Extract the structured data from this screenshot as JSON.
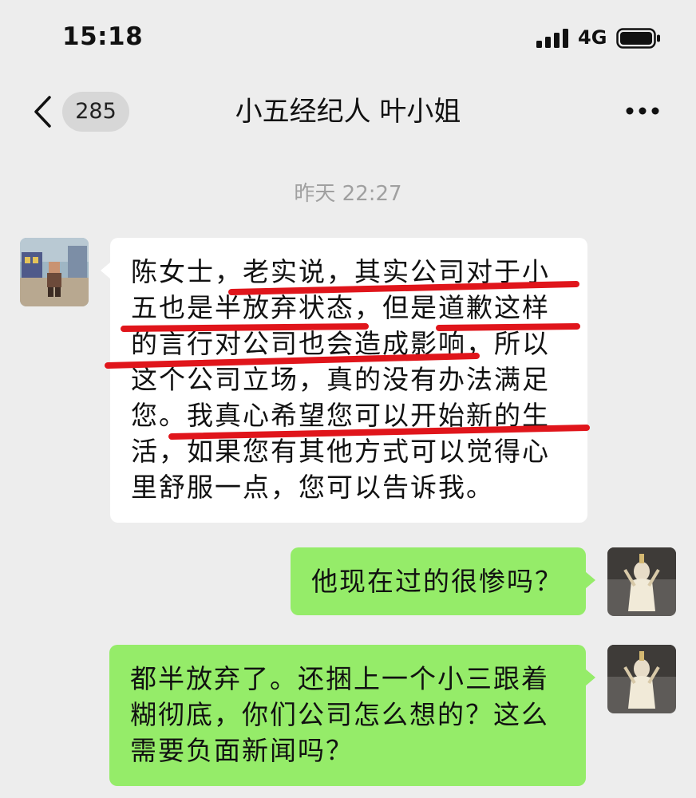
{
  "status_bar": {
    "time": "15:18",
    "network": "4G",
    "icons": [
      "signal-bars-icon",
      "battery-icon"
    ]
  },
  "nav": {
    "back_icon": "chevron-left-icon",
    "unread_count": "285",
    "title": "小五经纪人 叶小姐",
    "more_icon": "more-dots-icon"
  },
  "timestamp": "昨天 22:27",
  "messages": [
    {
      "sender": "contact",
      "avatar_icon": "game-character-avatar",
      "text": "陈女士，老实说，其实公司对于小五也是半放弃状态，但是道歉这样的言行对公司也会造成影响，所以这个公司立场，真的没有办法满足您。我真心希望您可以开始新的生活，如果您有其他方式可以觉得心里舒服一点，您可以告诉我。"
    },
    {
      "sender": "me",
      "avatar_icon": "goddess-statue-avatar",
      "text": "他现在过的很惨吗？"
    },
    {
      "sender": "me",
      "avatar_icon": "goddess-statue-avatar",
      "text": "都半放弃了。还捆上一个小三跟着糊彻底，你们公司怎么想的？这么需要负面新闻吗？"
    }
  ],
  "colors": {
    "background": "#ededed",
    "incoming_bubble": "#ffffff",
    "outgoing_bubble": "#95ec69",
    "annotation_red": "#e0151b",
    "timestamp_gray": "#a0a0a0"
  }
}
